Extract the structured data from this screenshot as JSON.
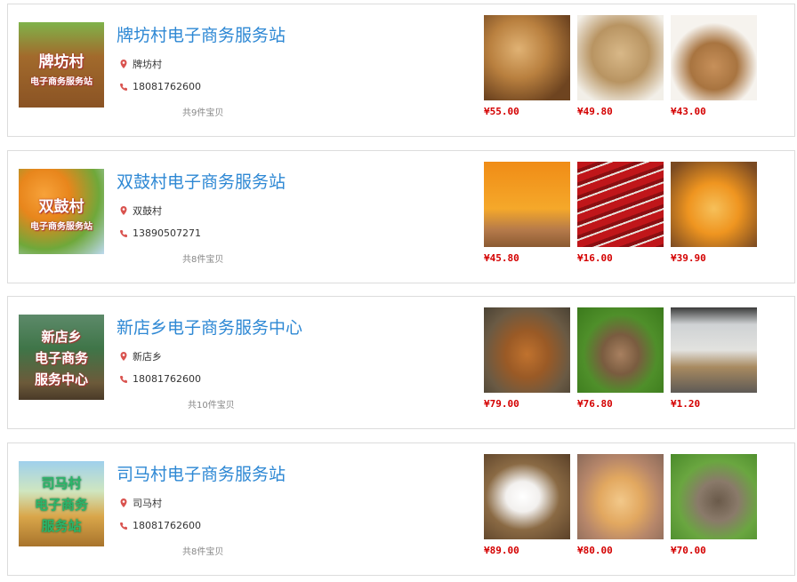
{
  "stations": [
    {
      "name": "牌坊村电子商务服务站",
      "logo_lines": [
        "牌坊村",
        "电子商务服务站"
      ],
      "location": "牌坊村",
      "phone": "18081762600",
      "count": "共9件宝贝",
      "products": [
        {
          "image": "walnut-photo",
          "price": "¥55.00"
        },
        {
          "image": "walnut-photo",
          "price": "¥49.80"
        },
        {
          "image": "walnut-basket-photo",
          "price": "¥43.00"
        }
      ]
    },
    {
      "name": "双鼓村电子商务服务站",
      "logo_lines": [
        "双鼓村",
        "电子商务服务站"
      ],
      "location": "双鼓村",
      "phone": "13890507271",
      "count": "共8件宝贝",
      "products": [
        {
          "image": "orange-photo",
          "price": "¥45.80"
        },
        {
          "image": "chili-photo",
          "price": "¥16.00"
        },
        {
          "image": "orange-photo",
          "price": "¥39.90"
        }
      ]
    },
    {
      "name": "新店乡电子商务服务中心",
      "logo_lines": [
        "新店乡",
        "电子商务",
        "服务中心"
      ],
      "location": "新店乡",
      "phone": "18081762600",
      "count": "共10件宝贝",
      "products": [
        {
          "image": "chicken-photo",
          "price": "¥79.00"
        },
        {
          "image": "duck-photo",
          "price": "¥76.80"
        },
        {
          "image": "office-photo",
          "price": "¥1.20"
        }
      ]
    },
    {
      "name": "司马村电子商务服务站",
      "logo_lines": [
        "司马村",
        "电子商务",
        "服务站"
      ],
      "location": "司马村",
      "phone": "18081762600",
      "count": "共8件宝贝",
      "products": [
        {
          "image": "rabbit-photo",
          "price": "¥89.00"
        },
        {
          "image": "hen-photo",
          "price": "¥80.00"
        },
        {
          "image": "duck-photo",
          "price": "¥70.00"
        }
      ]
    }
  ],
  "colors": {
    "title": "#2e88d4",
    "price": "#d40000",
    "icon": "#d9534f"
  }
}
